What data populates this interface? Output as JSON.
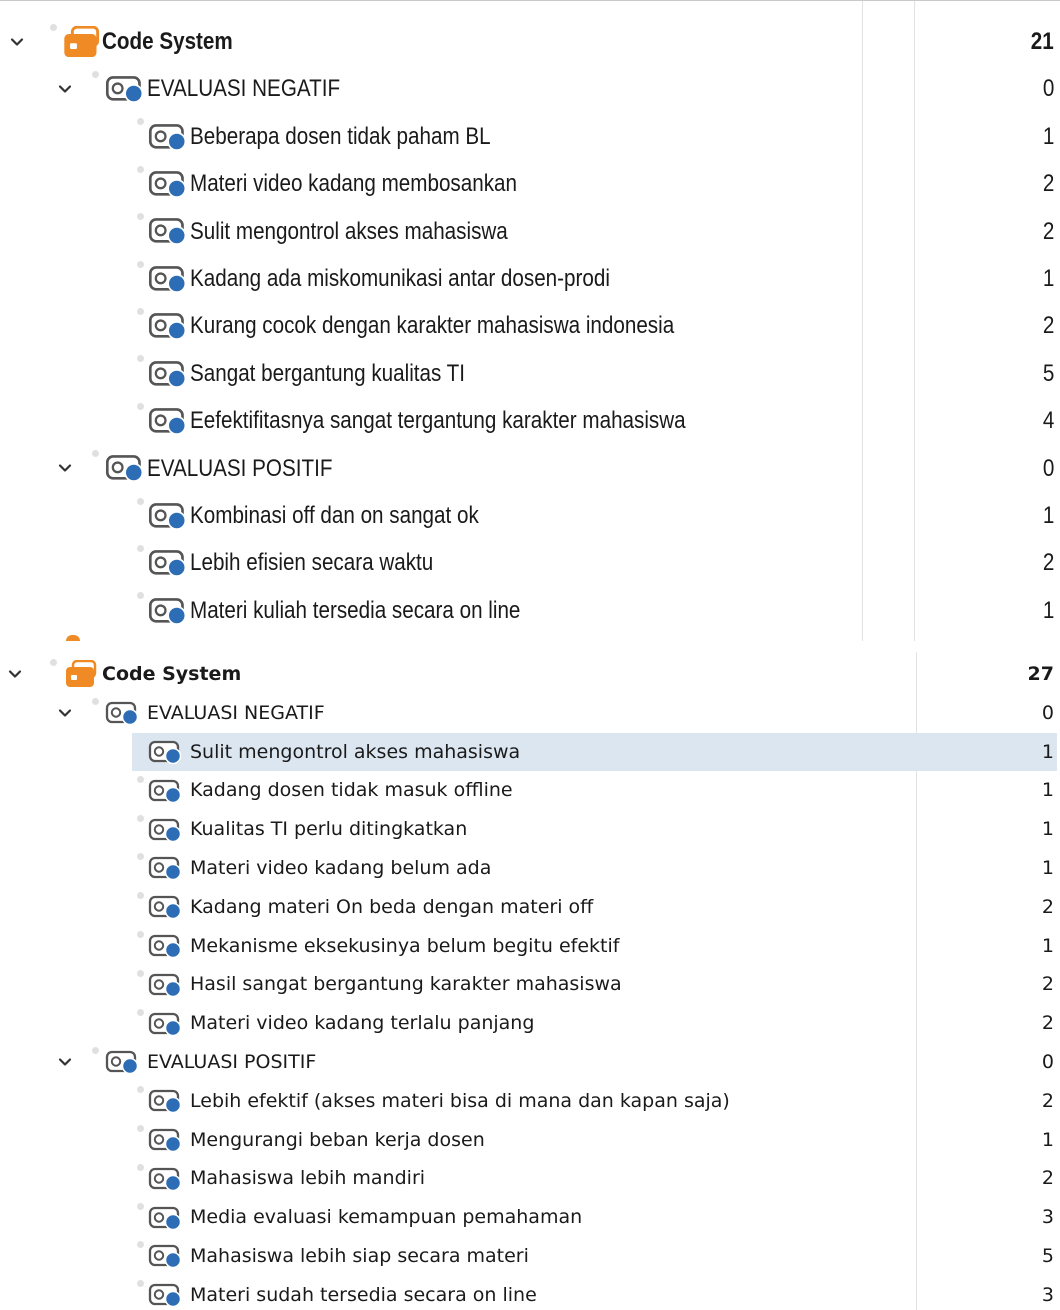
{
  "colors": {
    "accent_orange": "#f08a24",
    "code_blue": "#2d6db5",
    "selection": "#dce6f1"
  },
  "icons": {
    "expand": "chevron-down-icon",
    "root": "code-system-icon",
    "code": "code-icon"
  },
  "panel1": {
    "root": {
      "label": "Code System",
      "count": "21"
    },
    "groups": [
      {
        "label": "EVALUASI NEGATIF",
        "count": "0",
        "items": [
          {
            "label": "Beberapa dosen tidak paham BL",
            "count": "1"
          },
          {
            "label": "Materi video kadang membosankan",
            "count": "2"
          },
          {
            "label": "Sulit mengontrol akses mahasiswa",
            "count": "2"
          },
          {
            "label": "Kadang ada miskomunikasi antar dosen-prodi",
            "count": "1"
          },
          {
            "label": "Kurang cocok dengan karakter mahasiswa indonesia",
            "count": "2"
          },
          {
            "label": "Sangat bergantung kualitas TI",
            "count": "5"
          },
          {
            "label": "Eefektifitasnya sangat tergantung karakter mahasiswa",
            "count": "4"
          }
        ]
      },
      {
        "label": "EVALUASI POSITIF",
        "count": "0",
        "items": [
          {
            "label": "Kombinasi off dan on sangat ok",
            "count": "1"
          },
          {
            "label": "Lebih efisien secara waktu",
            "count": "2"
          },
          {
            "label": "Materi kuliah tersedia secara on line",
            "count": "1"
          }
        ]
      }
    ]
  },
  "panel2": {
    "root": {
      "label": "Code System",
      "count": "27"
    },
    "groups": [
      {
        "label": "EVALUASI NEGATIF",
        "count": "0",
        "items": [
          {
            "label": "Sulit mengontrol akses mahasiswa",
            "count": "1",
            "selected": true
          },
          {
            "label": "Kadang dosen tidak masuk offline",
            "count": "1"
          },
          {
            "label": "Kualitas TI perlu ditingkatkan",
            "count": "1"
          },
          {
            "label": "Materi video kadang belum ada",
            "count": "1"
          },
          {
            "label": "Kadang materi On beda dengan materi off",
            "count": "2"
          },
          {
            "label": "Mekanisme eksekusinya belum begitu efektif",
            "count": "1"
          },
          {
            "label": "Hasil sangat bergantung karakter mahasiswa",
            "count": "2"
          },
          {
            "label": "Materi video kadang terlalu panjang",
            "count": "2"
          }
        ]
      },
      {
        "label": "EVALUASI POSITIF",
        "count": "0",
        "items": [
          {
            "label": " Lebih efektif (akses materi bisa di mana dan kapan saja)",
            "count": "2"
          },
          {
            "label": "Mengurangi beban kerja dosen",
            "count": "1"
          },
          {
            "label": "Mahasiswa lebih mandiri",
            "count": "2"
          },
          {
            "label": "Media evaluasi kemampuan pemahaman",
            "count": "3"
          },
          {
            "label": "Mahasiswa lebih siap secara materi",
            "count": "5"
          },
          {
            "label": "Materi sudah tersedia secara on line",
            "count": "3"
          }
        ]
      }
    ]
  }
}
